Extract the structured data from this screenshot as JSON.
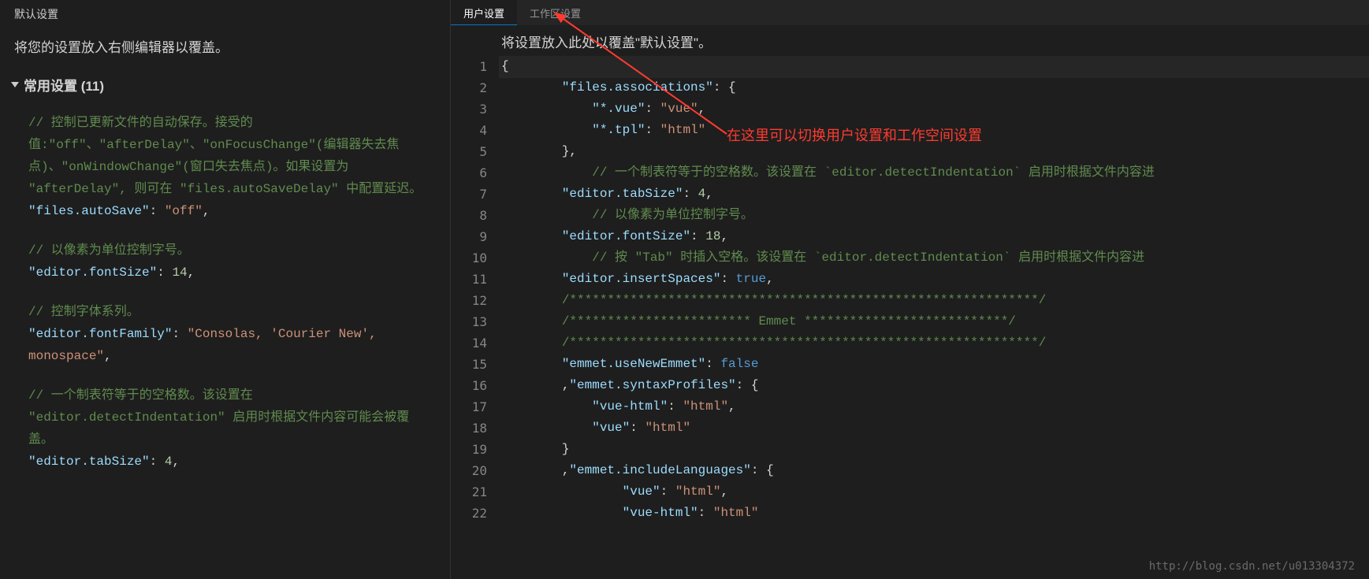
{
  "left": {
    "header": "默认设置",
    "instruction": "将您的设置放入右侧编辑器以覆盖。",
    "section_title": "常用设置 (11)",
    "blocks": [
      {
        "comment": "// 控制已更新文件的自动保存。接受的值:\"off\"、\"afterDelay\"、\"onFocusChange\"(编辑器失去焦点)、\"onWindowChange\"(窗口失去焦点)。如果设置为 \"afterDelay\", 则可在 \"files.autoSaveDelay\" 中配置延迟。",
        "key": "\"files.autoSave\"",
        "value": "\"off\"",
        "value_type": "string"
      },
      {
        "comment": "// 以像素为单位控制字号。",
        "key": "\"editor.fontSize\"",
        "value": "14",
        "value_type": "number"
      },
      {
        "comment": "// 控制字体系列。",
        "key": "\"editor.fontFamily\"",
        "value": "\"Consolas, 'Courier New', monospace\"",
        "value_type": "string"
      },
      {
        "comment": "// 一个制表符等于的空格数。该设置在 \"editor.detectIndentation\" 启用时根据文件内容可能会被覆盖。",
        "key": "\"editor.tabSize\"",
        "value": "4",
        "value_type": "number"
      }
    ]
  },
  "right": {
    "tabs": {
      "user": "用户设置",
      "workspace": "工作区设置"
    },
    "instruction": "将设置放入此处以覆盖\"默认设置\"。",
    "line_count": 22,
    "code_lines": [
      {
        "indent": 0,
        "tokens": [
          [
            "punct",
            "{"
          ]
        ]
      },
      {
        "indent": 2,
        "tokens": [
          [
            "key",
            "\"files.associations\""
          ],
          [
            "punct",
            ": {"
          ]
        ]
      },
      {
        "indent": 3,
        "tokens": [
          [
            "key",
            "\"*.vue\""
          ],
          [
            "punct",
            ": "
          ],
          [
            "string",
            "\"vue\""
          ],
          [
            "punct",
            ","
          ]
        ]
      },
      {
        "indent": 3,
        "tokens": [
          [
            "key",
            "\"*.tpl\""
          ],
          [
            "punct",
            ": "
          ],
          [
            "string",
            "\"html\""
          ]
        ]
      },
      {
        "indent": 2,
        "tokens": [
          [
            "punct",
            "},"
          ]
        ]
      },
      {
        "indent": 3,
        "tokens": [
          [
            "comment",
            "// 一个制表符等于的空格数。该设置在 `editor.detectIndentation` 启用时根据文件内容进"
          ]
        ]
      },
      {
        "indent": 2,
        "tokens": [
          [
            "key",
            "\"editor.tabSize\""
          ],
          [
            "punct",
            ": "
          ],
          [
            "number",
            "4"
          ],
          [
            "punct",
            ","
          ]
        ]
      },
      {
        "indent": 3,
        "tokens": [
          [
            "comment",
            "// 以像素为单位控制字号。"
          ]
        ]
      },
      {
        "indent": 2,
        "tokens": [
          [
            "key",
            "\"editor.fontSize\""
          ],
          [
            "punct",
            ": "
          ],
          [
            "number",
            "18"
          ],
          [
            "punct",
            ","
          ]
        ]
      },
      {
        "indent": 3,
        "tokens": [
          [
            "comment",
            "// 按 \"Tab\" 时插入空格。该设置在 `editor.detectIndentation` 启用时根据文件内容进"
          ]
        ]
      },
      {
        "indent": 2,
        "tokens": [
          [
            "key",
            "\"editor.insertSpaces\""
          ],
          [
            "punct",
            ": "
          ],
          [
            "boolean",
            "true"
          ],
          [
            "punct",
            ","
          ]
        ]
      },
      {
        "indent": 2,
        "tokens": [
          [
            "comment",
            "/**************************************************************/"
          ]
        ]
      },
      {
        "indent": 2,
        "tokens": [
          [
            "comment",
            "/************************ Emmet ***************************/"
          ]
        ]
      },
      {
        "indent": 2,
        "tokens": [
          [
            "comment",
            "/**************************************************************/"
          ]
        ]
      },
      {
        "indent": 2,
        "tokens": [
          [
            "key",
            "\"emmet.useNewEmmet\""
          ],
          [
            "punct",
            ": "
          ],
          [
            "boolean",
            "false"
          ]
        ]
      },
      {
        "indent": 2,
        "tokens": [
          [
            "punct",
            ","
          ],
          [
            "key",
            "\"emmet.syntaxProfiles\""
          ],
          [
            "punct",
            ": {"
          ]
        ]
      },
      {
        "indent": 3,
        "tokens": [
          [
            "key",
            "\"vue-html\""
          ],
          [
            "punct",
            ": "
          ],
          [
            "string",
            "\"html\""
          ],
          [
            "punct",
            ","
          ]
        ]
      },
      {
        "indent": 3,
        "tokens": [
          [
            "key",
            "\"vue\""
          ],
          [
            "punct",
            ": "
          ],
          [
            "string",
            "\"html\""
          ]
        ]
      },
      {
        "indent": 2,
        "tokens": [
          [
            "punct",
            "}"
          ]
        ]
      },
      {
        "indent": 2,
        "tokens": [
          [
            "punct",
            ","
          ],
          [
            "key",
            "\"emmet.includeLanguages\""
          ],
          [
            "punct",
            ": {"
          ]
        ]
      },
      {
        "indent": 4,
        "tokens": [
          [
            "key",
            "\"vue\""
          ],
          [
            "punct",
            ": "
          ],
          [
            "string",
            "\"html\""
          ],
          [
            "punct",
            ","
          ]
        ]
      },
      {
        "indent": 4,
        "tokens": [
          [
            "key",
            "\"vue-html\""
          ],
          [
            "punct",
            ": "
          ],
          [
            "string",
            "\"html\""
          ]
        ]
      }
    ]
  },
  "annotation": {
    "text": "在这里可以切换用户设置和工作空间设置"
  },
  "watermark": "http://blog.csdn.net/u013304372"
}
